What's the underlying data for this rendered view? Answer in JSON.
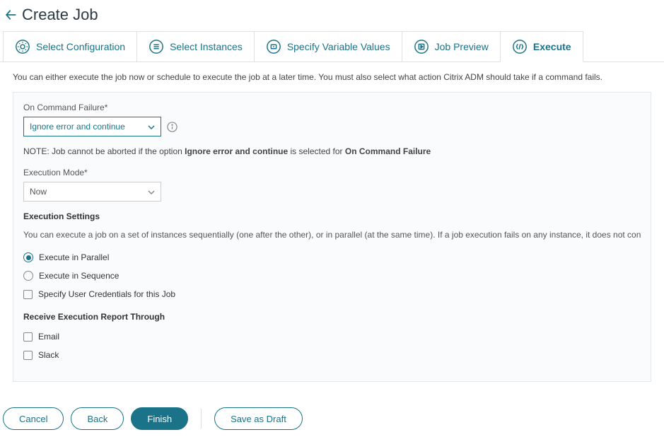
{
  "header": {
    "title": "Create Job"
  },
  "tabs": [
    {
      "label": "Select Configuration"
    },
    {
      "label": "Select Instances"
    },
    {
      "label": "Specify Variable Values"
    },
    {
      "label": "Job Preview"
    },
    {
      "label": "Execute"
    }
  ],
  "intro": "You can either execute the job now or schedule to execute the job at a later time. You must also select what action Citrix ADM should take if a command fails.",
  "onCommandFailure": {
    "label": "On Command Failure*",
    "value": "Ignore error and continue"
  },
  "note": {
    "prefix": "NOTE: Job cannot be aborted if the option ",
    "bold1": "Ignore error and continue",
    "middle": " is selected for ",
    "bold2": "On Command Failure"
  },
  "executionMode": {
    "label": "Execution Mode*",
    "value": "Now"
  },
  "settings": {
    "title": "Execution Settings",
    "desc": "You can execute a job on a set of instances sequentially (one after the other), or in parallel (at the same time). If a job execution fails on any instance, it does not continue execution on the remaining instances",
    "radioParallel": "Execute in Parallel",
    "radioSequence": "Execute in Sequence",
    "checkCreds": "Specify User Credentials for this Job"
  },
  "report": {
    "title": "Receive Execution Report Through",
    "email": "Email",
    "slack": "Slack"
  },
  "buttons": {
    "cancel": "Cancel",
    "back": "Back",
    "finish": "Finish",
    "saveDraft": "Save as Draft"
  }
}
